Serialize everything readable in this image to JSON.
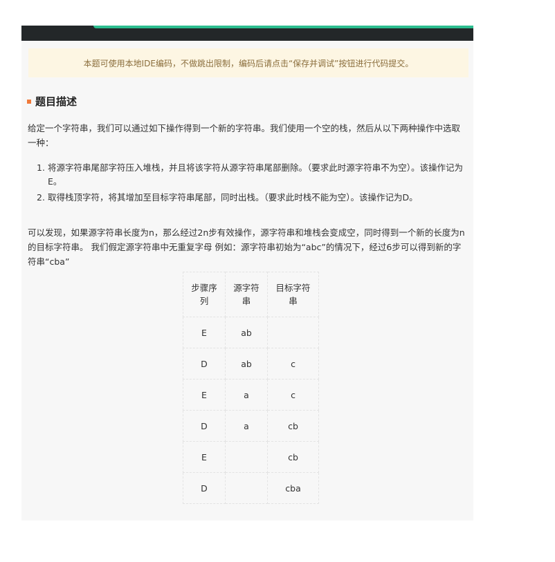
{
  "notice": "本题可使用本地IDE编码，不做跳出限制，编码后请点击“保存并调试”按钮进行代码提交。",
  "section": {
    "title": "题目描述"
  },
  "description": {
    "intro": "给定一个字符串，我们可以通过如下操作得到一个新的字符串。我们使用一个空的栈，然后从以下两种操作中选取一种：",
    "operations": [
      {
        "num": "1.",
        "text": "将源字符串尾部字符压入堆栈，并且将该字符从源字符串尾部删除。（要求此时源字符串不为空）。该操作记为E。"
      },
      {
        "num": "2.",
        "text": "取得栈顶字符，将其增加至目标字符串尾部，同时出栈。（要求此时栈不能为空）。该操作记为D。"
      }
    ],
    "followup": "可以发现，如果源字符串长度为n，那么经过2n步有效操作，源字符串和堆栈会变成空，同时得到一个新的长度为n的目标字符串。 我们假定源字符串中无重复字母 例如：源字符串初始为“abc”的情况下，经过6步可以得到新的字符串“cba”"
  },
  "table": {
    "headers": [
      "步骤序列",
      "源字符串",
      "目标字符串"
    ],
    "rows": [
      [
        "E",
        "ab",
        ""
      ],
      [
        "D",
        "ab",
        "c"
      ],
      [
        "E",
        "a",
        "c"
      ],
      [
        "D",
        "a",
        "cb"
      ],
      [
        "E",
        "",
        "cb"
      ],
      [
        "D",
        "",
        "cba"
      ]
    ]
  },
  "colors": {
    "topbar": "#232729",
    "accent": "#2dbd8f",
    "notice_bg": "#fdf6e3",
    "notice_text": "#8a6d3b",
    "section_marker": "#f07a3a",
    "panel_bg": "#f7f7f7"
  }
}
